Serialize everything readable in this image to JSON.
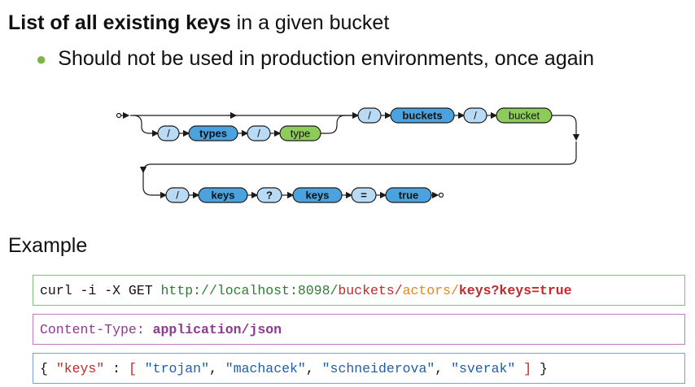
{
  "heading": {
    "bold": "List of all existing keys",
    "rest": " in a given bucket"
  },
  "bullet": "Should not be used in production environments, once again",
  "diagram": {
    "row1_optional": [
      "/",
      "types",
      "/",
      "type"
    ],
    "row1_main": [
      "/",
      "buckets",
      "/",
      "bucket"
    ],
    "row2": [
      "/",
      "keys",
      "?",
      "keys",
      "=",
      "true"
    ]
  },
  "example_label": "Example",
  "code1": {
    "cmd": "curl -i -X GET ",
    "host": "http://localhost:8098/",
    "buckets": "buckets/",
    "actors": "actors/",
    "keys": "keys?keys=true"
  },
  "code2": {
    "key": "Content-Type: ",
    "value": "application/json"
  },
  "code3": {
    "open": "{ ",
    "k": "\"keys\"",
    "colon": " : ",
    "lb": "[ ",
    "v1": "\"trojan\"",
    "v2": "\"machacek\"",
    "v3": "\"schneiderova\"",
    "v4": "\"sverak\"",
    "rb": " ]",
    "close": " }"
  }
}
